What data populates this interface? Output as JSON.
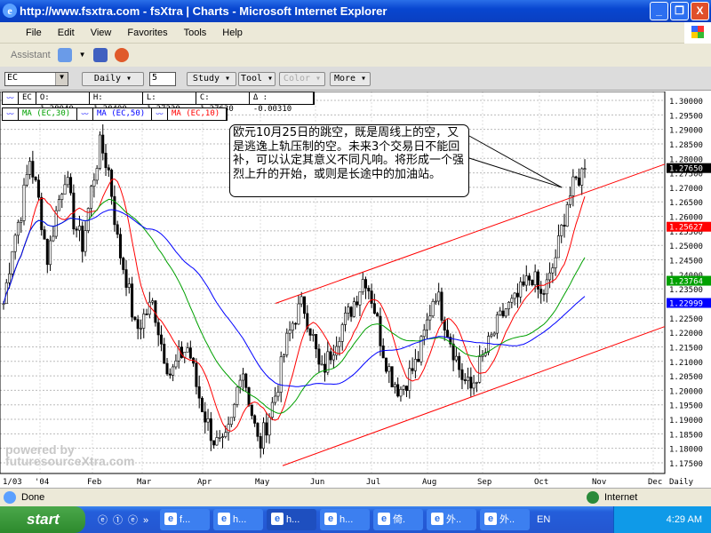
{
  "window": {
    "title": "http://www.fsxtra.com - fsXtra | Charts - Microsoft Internet Explorer",
    "min": "_",
    "max": "❐",
    "close": "X"
  },
  "menu": [
    "File",
    "Edit",
    "View",
    "Favorites",
    "Tools",
    "Help"
  ],
  "toolbar": {
    "assistant": "Assistant"
  },
  "chart_toolbar": {
    "symbol": "EC",
    "period": "Daily ▾",
    "count": "5",
    "study": "Study ▾",
    "tool": "Tool ▾",
    "color": "Color ▾",
    "more": "More ▾"
  },
  "quote": {
    "symbol": "EC",
    "open": "O: 1.28040",
    "high": "H: 1.28400",
    "low": "L: 1.27230",
    "close": "C: 1.27630",
    "change": "Δ : -0.00310"
  },
  "studies": [
    {
      "label": "MA (EC,30)",
      "color": "#00a000"
    },
    {
      "label": "MA (EC,50)",
      "color": "#0000ff"
    },
    {
      "label": "MA (EC,10)",
      "color": "#ff0000"
    }
  ],
  "annotation": "欧元10月25日的跳空，既是周线上的空，又是逃逸上轨压制的空。未来3个交易日不能回补，可以认定其意义不同凡响。将形成一个强烈上升的开始，或则是长途中的加油站。",
  "watermark": "powered by futuresourceXtra.com",
  "chart_data": {
    "type": "candlestick",
    "ylim": [
      1.17,
      1.305
    ],
    "yticks": [
      "1.30000",
      "1.29500",
      "1.29000",
      "1.28500",
      "1.28000",
      "1.27500",
      "1.27000",
      "1.26500",
      "1.26000",
      "1.25500",
      "1.25000",
      "1.24500",
      "1.24000",
      "1.23500",
      "1.23000",
      "1.22500",
      "1.22000",
      "1.21500",
      "1.21000",
      "1.20500",
      "1.20000",
      "1.19500",
      "1.19000",
      "1.18500",
      "1.18000",
      "1.17500"
    ],
    "xticks": [
      "1/03",
      "'04",
      "Feb",
      "Mar",
      "Apr",
      "May",
      "Jun",
      "Jul",
      "Aug",
      "Sep",
      "Oct",
      "Nov",
      "Dec",
      "Daily"
    ],
    "price_labels": [
      {
        "value": "1.27650",
        "color": "#000000"
      },
      {
        "value": "1.25627",
        "color": "#ff0000"
      },
      {
        "value": "1.23764",
        "color": "#00a000"
      },
      {
        "value": "1.22999",
        "color": "#0000ff"
      }
    ],
    "close_path": [
      1.23,
      1.25,
      1.262,
      1.28,
      1.265,
      1.245,
      1.262,
      1.275,
      1.258,
      1.25,
      1.27,
      1.285,
      1.275,
      1.25,
      1.238,
      1.22,
      1.226,
      1.23,
      1.215,
      1.205,
      1.212,
      1.215,
      1.2,
      1.19,
      1.182,
      1.18,
      1.19,
      1.21,
      1.195,
      1.18,
      1.19,
      1.2,
      1.215,
      1.225,
      1.23,
      1.22,
      1.205,
      1.212,
      1.22,
      1.225,
      1.232,
      1.24,
      1.23,
      1.215,
      1.205,
      1.2,
      1.205,
      1.21,
      1.222,
      1.235,
      1.225,
      1.215,
      1.205,
      1.2,
      1.208,
      1.215,
      1.222,
      1.228,
      1.23,
      1.235,
      1.24,
      1.232,
      1.238,
      1.25,
      1.265,
      1.272,
      1.2765
    ],
    "channel": {
      "upper": [
        1.23,
        1.278
      ],
      "lower": [
        1.174,
        1.222
      ]
    }
  },
  "status": {
    "text": "Done",
    "zone": "Internet"
  },
  "taskbar": {
    "start": "start",
    "tasks": [
      "f...",
      "h...",
      "h...",
      "h...",
      "倚.",
      "外..",
      "外.."
    ],
    "lang": "EN",
    "time": "4:29 AM"
  }
}
